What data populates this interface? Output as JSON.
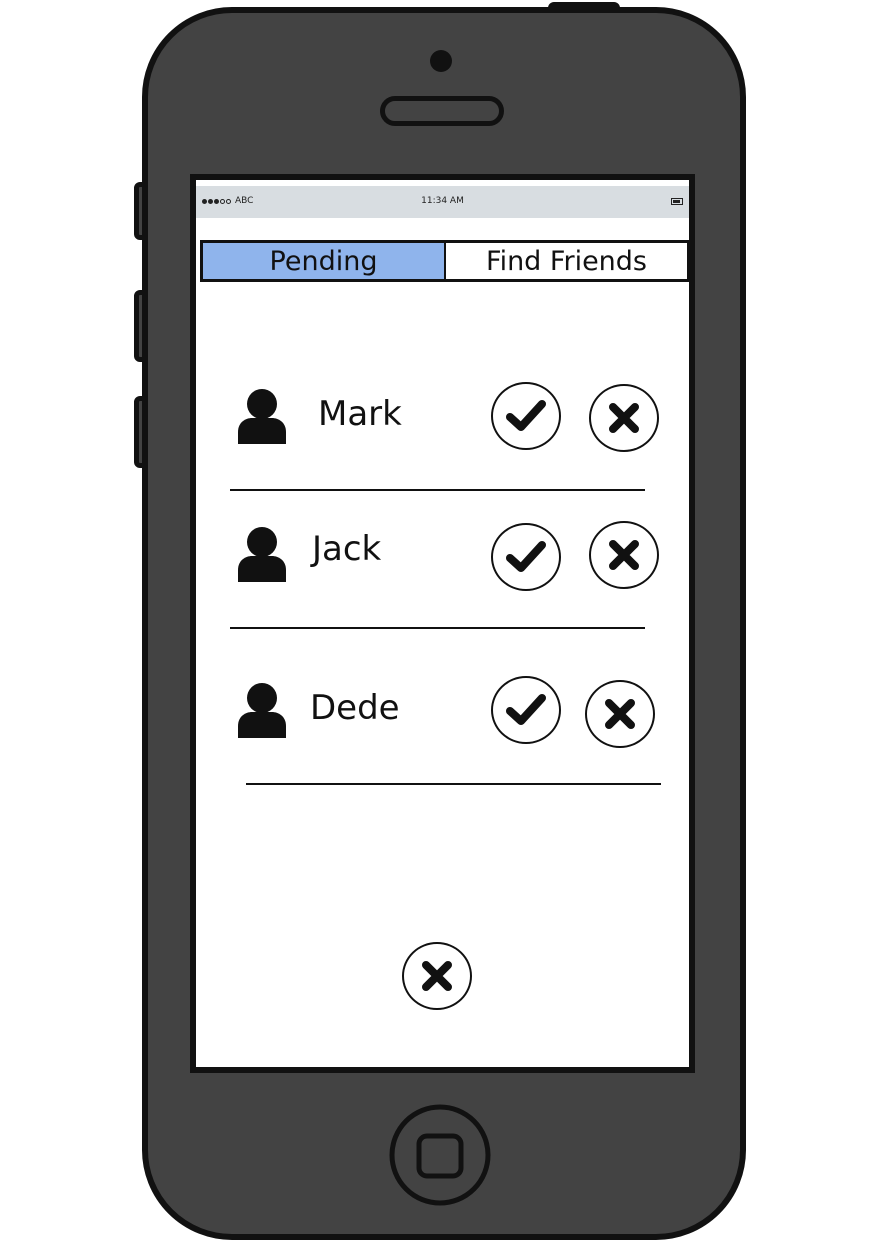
{
  "status_bar": {
    "carrier": "ABC",
    "time": "11:34 AM"
  },
  "tabs": [
    {
      "label": "Pending",
      "active": true
    },
    {
      "label": "Find Friends",
      "active": false
    }
  ],
  "pending_requests": [
    {
      "name": "Mark"
    },
    {
      "name": "Jack"
    },
    {
      "name": "Dede"
    }
  ],
  "icons": {
    "avatar": "user-icon",
    "accept": "checkmark-icon",
    "decline": "x-icon"
  },
  "colors": {
    "active_tab": "#8fb4ec",
    "phone_body": "#434343",
    "status_bar": "#d8dde1"
  }
}
